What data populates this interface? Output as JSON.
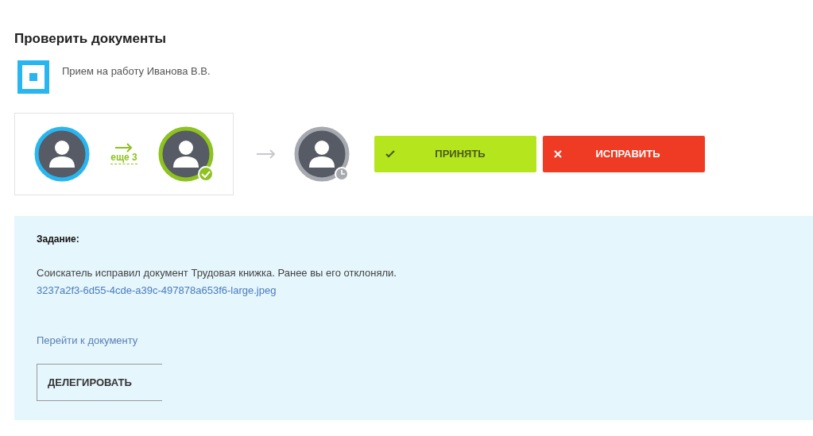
{
  "title": "Проверить документы",
  "document": {
    "name": "Прием на работу Иванова В.В."
  },
  "chain": {
    "group": [
      {
        "color": "#29b6f0",
        "kind": "plain"
      },
      {
        "color": "#8dc21f",
        "kind": "approved"
      }
    ],
    "more_link": "еще 3",
    "next": [
      {
        "color": "#a6a9b0",
        "kind": "pending"
      }
    ]
  },
  "actions": [
    {
      "kind": "accept",
      "label": "ПРИНЯТЬ"
    },
    {
      "kind": "fix",
      "label": "ИСПРАВИТЬ"
    }
  ],
  "task": {
    "heading": "Задание:",
    "message": "Соискатель исправил документ Трудовая книжка. Ранее вы его отклоняли.",
    "file_link": "3237a2f3-6d55-4cde-a39c-497878a653f6-large.jpeg",
    "doc_link": "Перейти к документу",
    "delegate_button": "ДЕЛЕГИРОВАТЬ"
  }
}
